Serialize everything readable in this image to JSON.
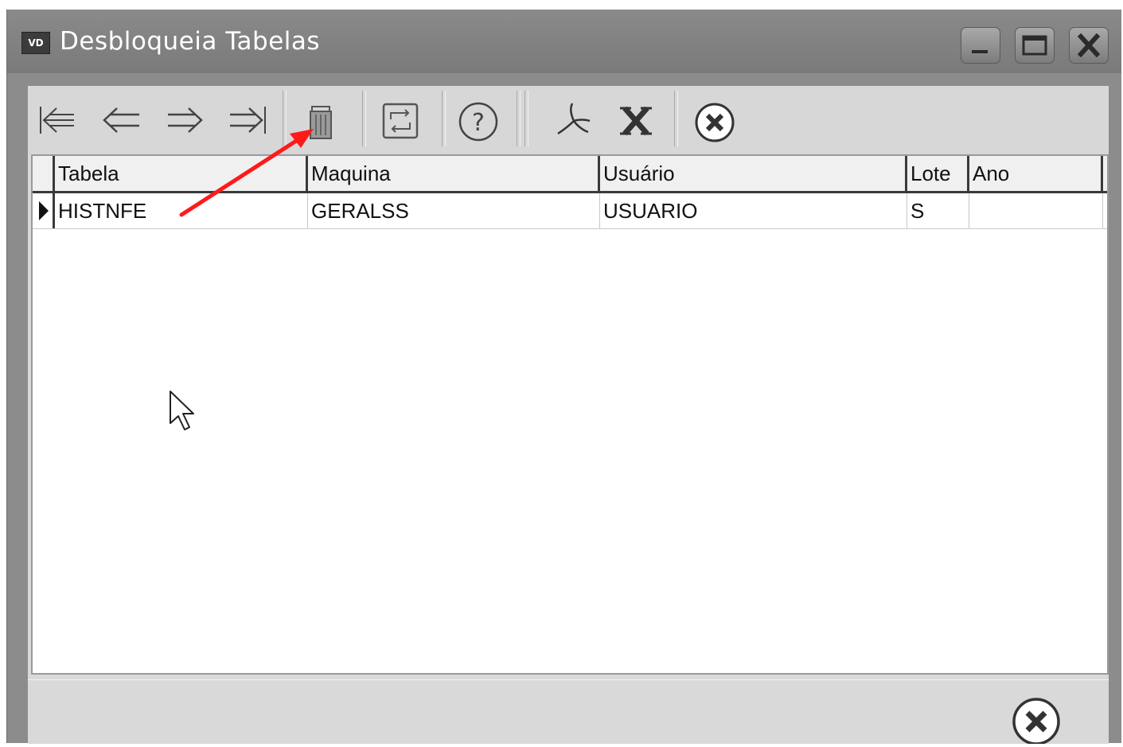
{
  "window": {
    "app_icon_text": "VD",
    "title": "Desbloqueia Tabelas"
  },
  "toolbar": {
    "buttons": [
      {
        "name": "first-record",
        "icon": "first-icon"
      },
      {
        "name": "prior-record",
        "icon": "prior-arrow-icon"
      },
      {
        "name": "next-record",
        "icon": "next-arrow-icon"
      },
      {
        "name": "last-record",
        "icon": "last-icon"
      },
      {
        "name": "delete",
        "icon": "trash-icon"
      },
      {
        "name": "refresh",
        "icon": "refresh-icon"
      },
      {
        "name": "help",
        "icon": "help-icon"
      },
      {
        "name": "export-pdf",
        "icon": "pdf-icon"
      },
      {
        "name": "export-excel",
        "icon": "excel-icon"
      },
      {
        "name": "close",
        "icon": "close-circle-icon"
      }
    ]
  },
  "grid": {
    "columns": [
      "Tabela",
      "Maquina",
      "Usuário",
      "Lote",
      "Ano"
    ],
    "rows": [
      [
        "HISTNFE",
        "GERALSS",
        "USUARIO",
        "S",
        ""
      ]
    ]
  },
  "annotation": {
    "arrow_color": "#ff1a1a"
  }
}
